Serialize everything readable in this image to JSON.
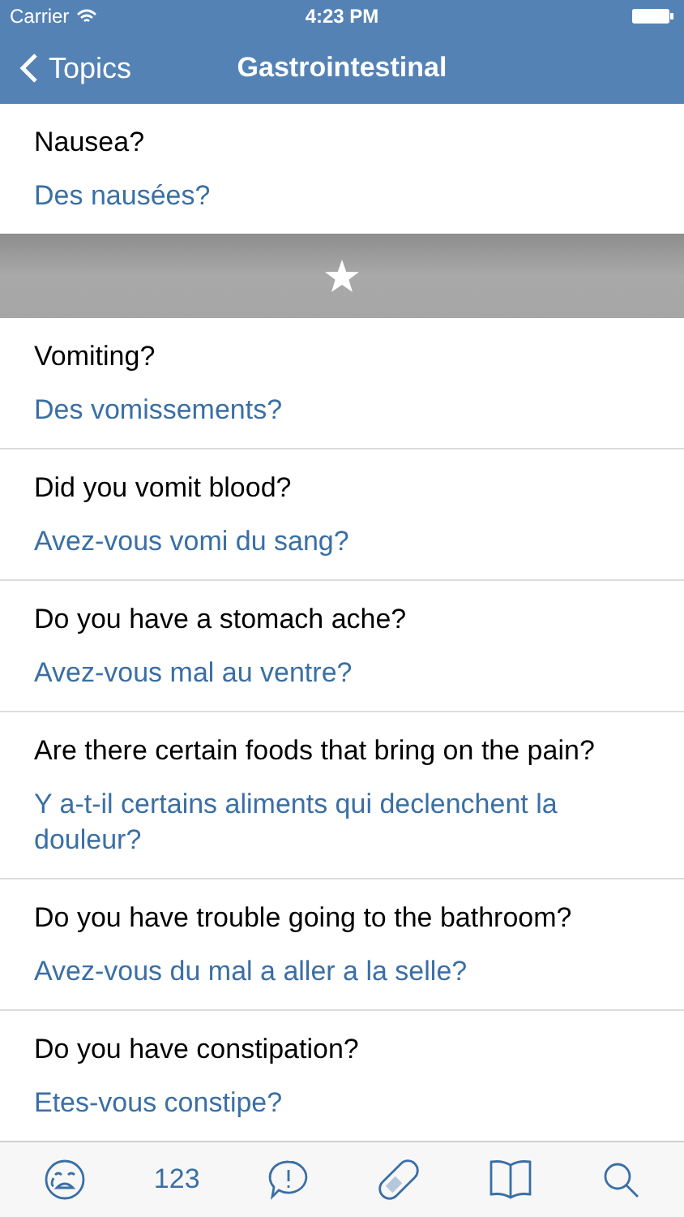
{
  "status_bar": {
    "carrier": "Carrier",
    "time": "4:23 PM"
  },
  "nav": {
    "back": "Topics",
    "title": "Gastrointestinal"
  },
  "top_row": {
    "english": "Nausea?",
    "french": "Des nausées?"
  },
  "rows": [
    {
      "english": "Vomiting?",
      "french": "Des vomissements?"
    },
    {
      "english": "Did you vomit blood?",
      "french": "Avez-vous vomi du sang?"
    },
    {
      "english": "Do you have a stomach ache?",
      "french": "Avez-vous mal au ventre?"
    },
    {
      "english": "Are there certain foods that bring on the pain?",
      "french": "Y a-t-il certains aliments qui declenchent la douleur?"
    },
    {
      "english": "Do you have trouble going to the bathroom?",
      "french": "Avez-vous du mal a aller a la selle?"
    },
    {
      "english": "Do you have constipation?",
      "french": "Etes-vous constipe?"
    }
  ],
  "tab_bar": {
    "items": [
      {
        "kind": "face"
      },
      {
        "kind": "text",
        "label": "123"
      },
      {
        "kind": "alert"
      },
      {
        "kind": "pill"
      },
      {
        "kind": "book"
      },
      {
        "kind": "search"
      }
    ]
  }
}
